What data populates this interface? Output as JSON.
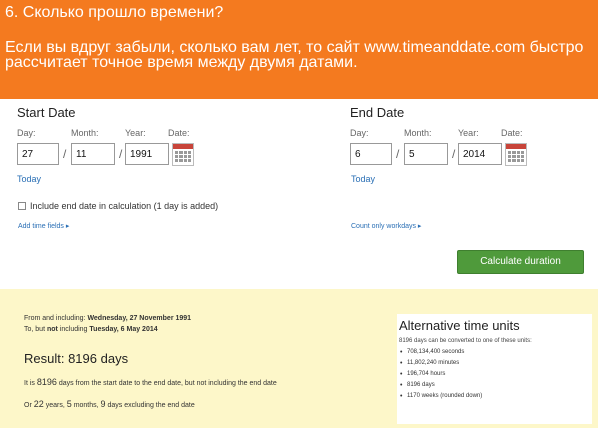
{
  "banner": {
    "title": "6. Сколько прошло времени?",
    "text": "Если вы вдруг забыли, сколько вам лет, то сайт www.timeanddate.com быстро рассчитает точное время между двумя датами."
  },
  "start": {
    "heading": "Start Date",
    "day_label": "Day:",
    "month_label": "Month:",
    "year_label": "Year:",
    "date_label": "Date:",
    "day": "27",
    "month": "11",
    "year": "1991",
    "today": "Today"
  },
  "end": {
    "heading": "End Date",
    "day_label": "Day:",
    "month_label": "Month:",
    "year_label": "Year:",
    "date_label": "Date:",
    "day": "6",
    "month": "5",
    "year": "2014",
    "today": "Today"
  },
  "include_end": "Include end date in calculation (1 day is added)",
  "add_time": "Add time fields",
  "count_workdays": "Count only workdays",
  "calculate_label": "Calculate duration",
  "result": {
    "from_prefix": "From and including:",
    "from_date": "Wednesday, 27 November 1991",
    "to_prefix": "To, but",
    "to_not": "not",
    "to_mid": "including",
    "to_date": "Tuesday, 6 May 2014",
    "title": "Result: 8196 days",
    "desc_pre": "It is",
    "desc_num": "8196",
    "desc_post": "days from the start date to the end date, but not including the end date",
    "or_pre": "Or",
    "or_years": "22",
    "or_years_unit": "years,",
    "or_months": "5",
    "or_months_unit": "months,",
    "or_days": "9",
    "or_days_unit": "days",
    "or_post": "excluding the end date"
  },
  "alt": {
    "heading": "Alternative time units",
    "intro": "8196 days can be converted to one of these units:",
    "items": [
      "708,134,400 seconds",
      "11,802,240 minutes",
      "196,704 hours",
      "8196 days",
      "1170 weeks (rounded down)"
    ]
  },
  "colors": {
    "banner": "#f47a1f",
    "button": "#4f9a3b",
    "results_bg": "#fdf7c9",
    "link": "#2a6fb5"
  }
}
